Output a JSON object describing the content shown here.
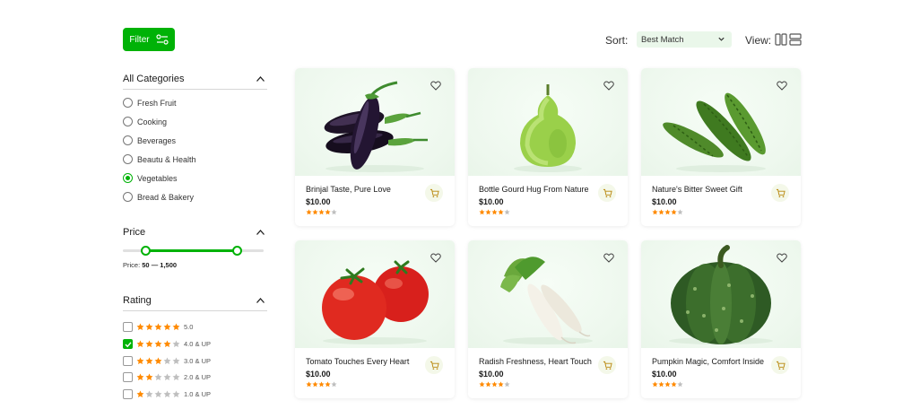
{
  "filter_button": {
    "label": "Filter",
    "icon": "sliders-icon"
  },
  "sort": {
    "label": "Sort:",
    "selected": "Best Match"
  },
  "view": {
    "label": "View:"
  },
  "categories": {
    "title": "All Categories",
    "items": [
      {
        "label": "Fresh Fruit",
        "selected": false
      },
      {
        "label": "Cooking",
        "selected": false
      },
      {
        "label": "Beverages",
        "selected": false
      },
      {
        "label": "Beautu & Health",
        "selected": false
      },
      {
        "label": "Vegetables",
        "selected": true
      },
      {
        "label": "Bread & Bakery",
        "selected": false
      }
    ]
  },
  "price": {
    "title": "Price",
    "label_prefix": "Price:",
    "range_text": "50 — 1,500",
    "slider_fill_start": 0.16,
    "slider_fill_end": 0.81
  },
  "rating": {
    "title": "Rating",
    "options": [
      {
        "stars": 5,
        "label": "5.0",
        "checked": false
      },
      {
        "stars": 4,
        "label": "4.0 & UP",
        "checked": true
      },
      {
        "stars": 3,
        "label": "3.0 & UP",
        "checked": false
      },
      {
        "stars": 2,
        "label": "2.0 & UP",
        "checked": false
      },
      {
        "stars": 1,
        "label": "1.0 & UP",
        "checked": false
      }
    ]
  },
  "colors": {
    "accent": "#00b207",
    "star": "#ff8a00",
    "star_empty": "#bfbfbf"
  },
  "products": [
    {
      "name": "Brinjal Taste, Pure Love",
      "price": "$10.00",
      "rating": 4,
      "image": "eggplant"
    },
    {
      "name": "Bottle Gourd Hug From Nature",
      "price": "$10.00",
      "rating": 4,
      "image": "bottle-gourd"
    },
    {
      "name": "Nature's Bitter Sweet Gift",
      "price": "$10.00",
      "rating": 4,
      "image": "bitter-gourd"
    },
    {
      "name": "Tomato Touches Every Heart",
      "price": "$10.00",
      "rating": 4,
      "image": "tomato"
    },
    {
      "name": "Radish Freshness, Heart Touch",
      "price": "$10.00",
      "rating": 4,
      "image": "radish"
    },
    {
      "name": "Pumpkin Magic, Comfort Inside",
      "price": "$10.00",
      "rating": 4,
      "image": "pumpkin"
    }
  ]
}
